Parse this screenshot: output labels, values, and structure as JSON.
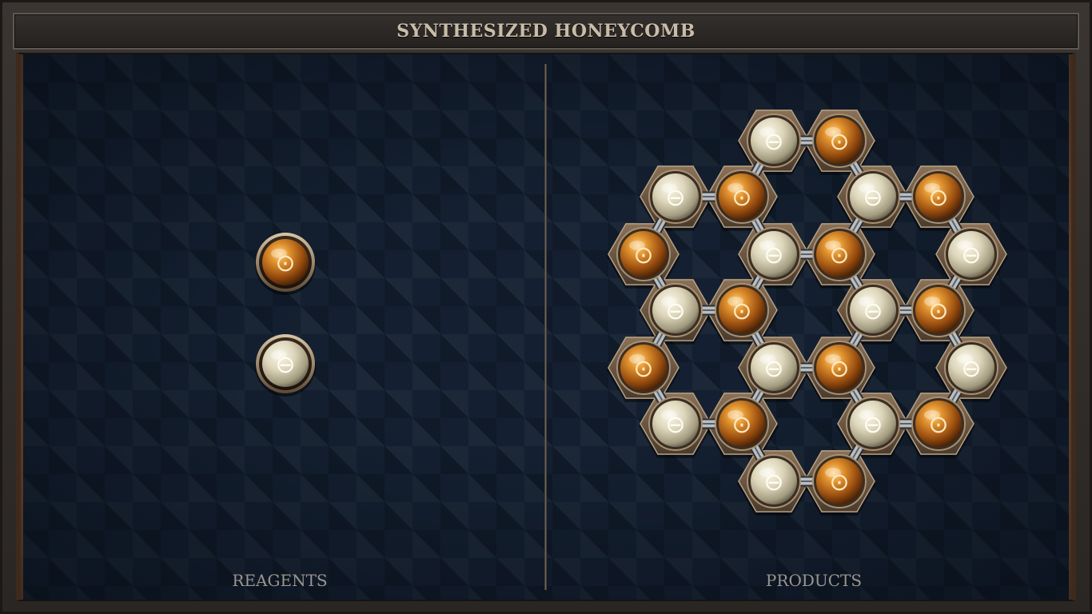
{
  "title": "SYNTHESIZED HONEYCOMB",
  "sections": {
    "reagents": "REAGENTS",
    "products": "PRODUCTS"
  },
  "colors": {
    "board": "#142031",
    "frame": "#2a2623",
    "copper": "#c97a1f",
    "pearl": "#e7e1c8",
    "hex_tile": "#6e5a45",
    "bond": "#b8bcc0"
  },
  "symbols": {
    "copper": "⊙",
    "pearl": "⊖"
  },
  "reagents": [
    {
      "type": "copper",
      "name": "reagent-copper-atom"
    },
    {
      "type": "pearl",
      "name": "reagent-pearl-atom"
    }
  ],
  "product": {
    "atom_types": [
      "pearl",
      "copper",
      "pearl",
      "copper",
      "pearl",
      "copper",
      "copper",
      "pearl",
      "copper",
      "pearl",
      "pearl",
      "copper",
      "pearl",
      "copper",
      "copper",
      "pearl",
      "copper",
      "pearl",
      "pearl",
      "copper",
      "pearl",
      "copper",
      "pearl",
      "copper"
    ]
  }
}
